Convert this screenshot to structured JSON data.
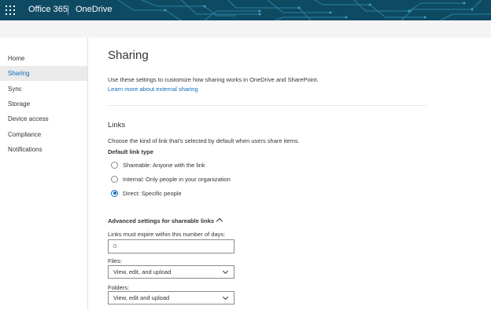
{
  "header": {
    "suite_name": "Office 365",
    "app_name": "OneDrive",
    "waffle_icon": "app-launcher-icon",
    "background_color": "#0f4a63"
  },
  "sidebar": {
    "items": [
      {
        "label": "Home",
        "active": false
      },
      {
        "label": "Sharing",
        "active": true
      },
      {
        "label": "Sync",
        "active": false
      },
      {
        "label": "Storage",
        "active": false
      },
      {
        "label": "Device access",
        "active": false
      },
      {
        "label": "Compliance",
        "active": false
      },
      {
        "label": "Notifications",
        "active": false
      }
    ]
  },
  "main": {
    "title": "Sharing",
    "description": "Use these settings to customize how sharing works in OneDrive and SharePoint.",
    "learn_more_link": "Learn more about external sharing",
    "links_section": {
      "title": "Links",
      "description": "Choose the kind of link that's selected by default when users share items.",
      "default_link_type_label": "Default link type",
      "options": [
        {
          "label": "Shareable: Anyone with the link",
          "checked": false
        },
        {
          "label": "Internal: Only people in your organization",
          "checked": false
        },
        {
          "label": "Direct: Specific people",
          "checked": true
        }
      ]
    },
    "advanced": {
      "heading": "Advanced settings for shareable links",
      "expire_label": "Links must expire within this number of days:",
      "expire_value": "0",
      "files_label": "Files:",
      "files_value": "View, edit, and upload",
      "folders_label": "Folders:",
      "folders_value": "View, edit and upload"
    }
  },
  "colors": {
    "accent": "#0f6cbd",
    "active_nav_bg": "#eaeaea"
  }
}
